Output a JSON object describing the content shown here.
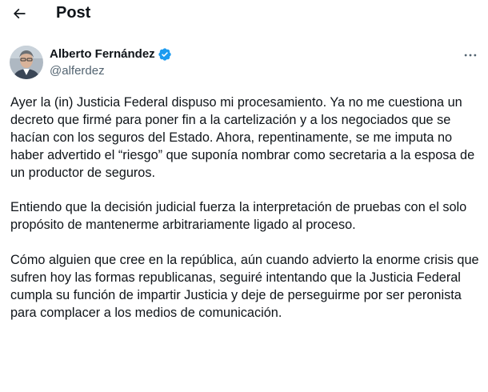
{
  "header": {
    "title": "Post",
    "back_icon": "arrow-left-icon"
  },
  "author": {
    "name": "Alberto Fernández",
    "handle": "@alferdez",
    "verified_icon": "verified-badge-icon",
    "verified_color": "#1d9bf0",
    "avatar_icon": "user-avatar"
  },
  "menu": {
    "more_icon": "more-horizontal-icon"
  },
  "tweet": {
    "paragraphs": [
      "Ayer la (in) Justicia Federal dispuso mi procesamiento. Ya no me cuestiona un decreto que firmé para poner fin a la cartelización y a los negociados que se hacían con los seguros del Estado. Ahora, repentinamente, se me imputa no haber advertido el “riesgo” que suponía nombrar como secretaria a la esposa de un productor de seguros.",
      "Entiendo que la decisión judicial fuerza la interpretación de pruebas con el solo propósito de mantenerme arbitrariamente ligado al proceso.",
      "Cómo alguien que cree en la república, aún cuando advierto la enorme crisis que sufren hoy las formas republicanas, seguiré intentando que la Justicia Federal cumpla su función de impartir Justicia y deje de perseguirme por ser peronista para complacer a los medios de comunicación."
    ]
  },
  "colors": {
    "text": "#0f1419",
    "secondary": "#536471",
    "accent": "#1d9bf0"
  }
}
